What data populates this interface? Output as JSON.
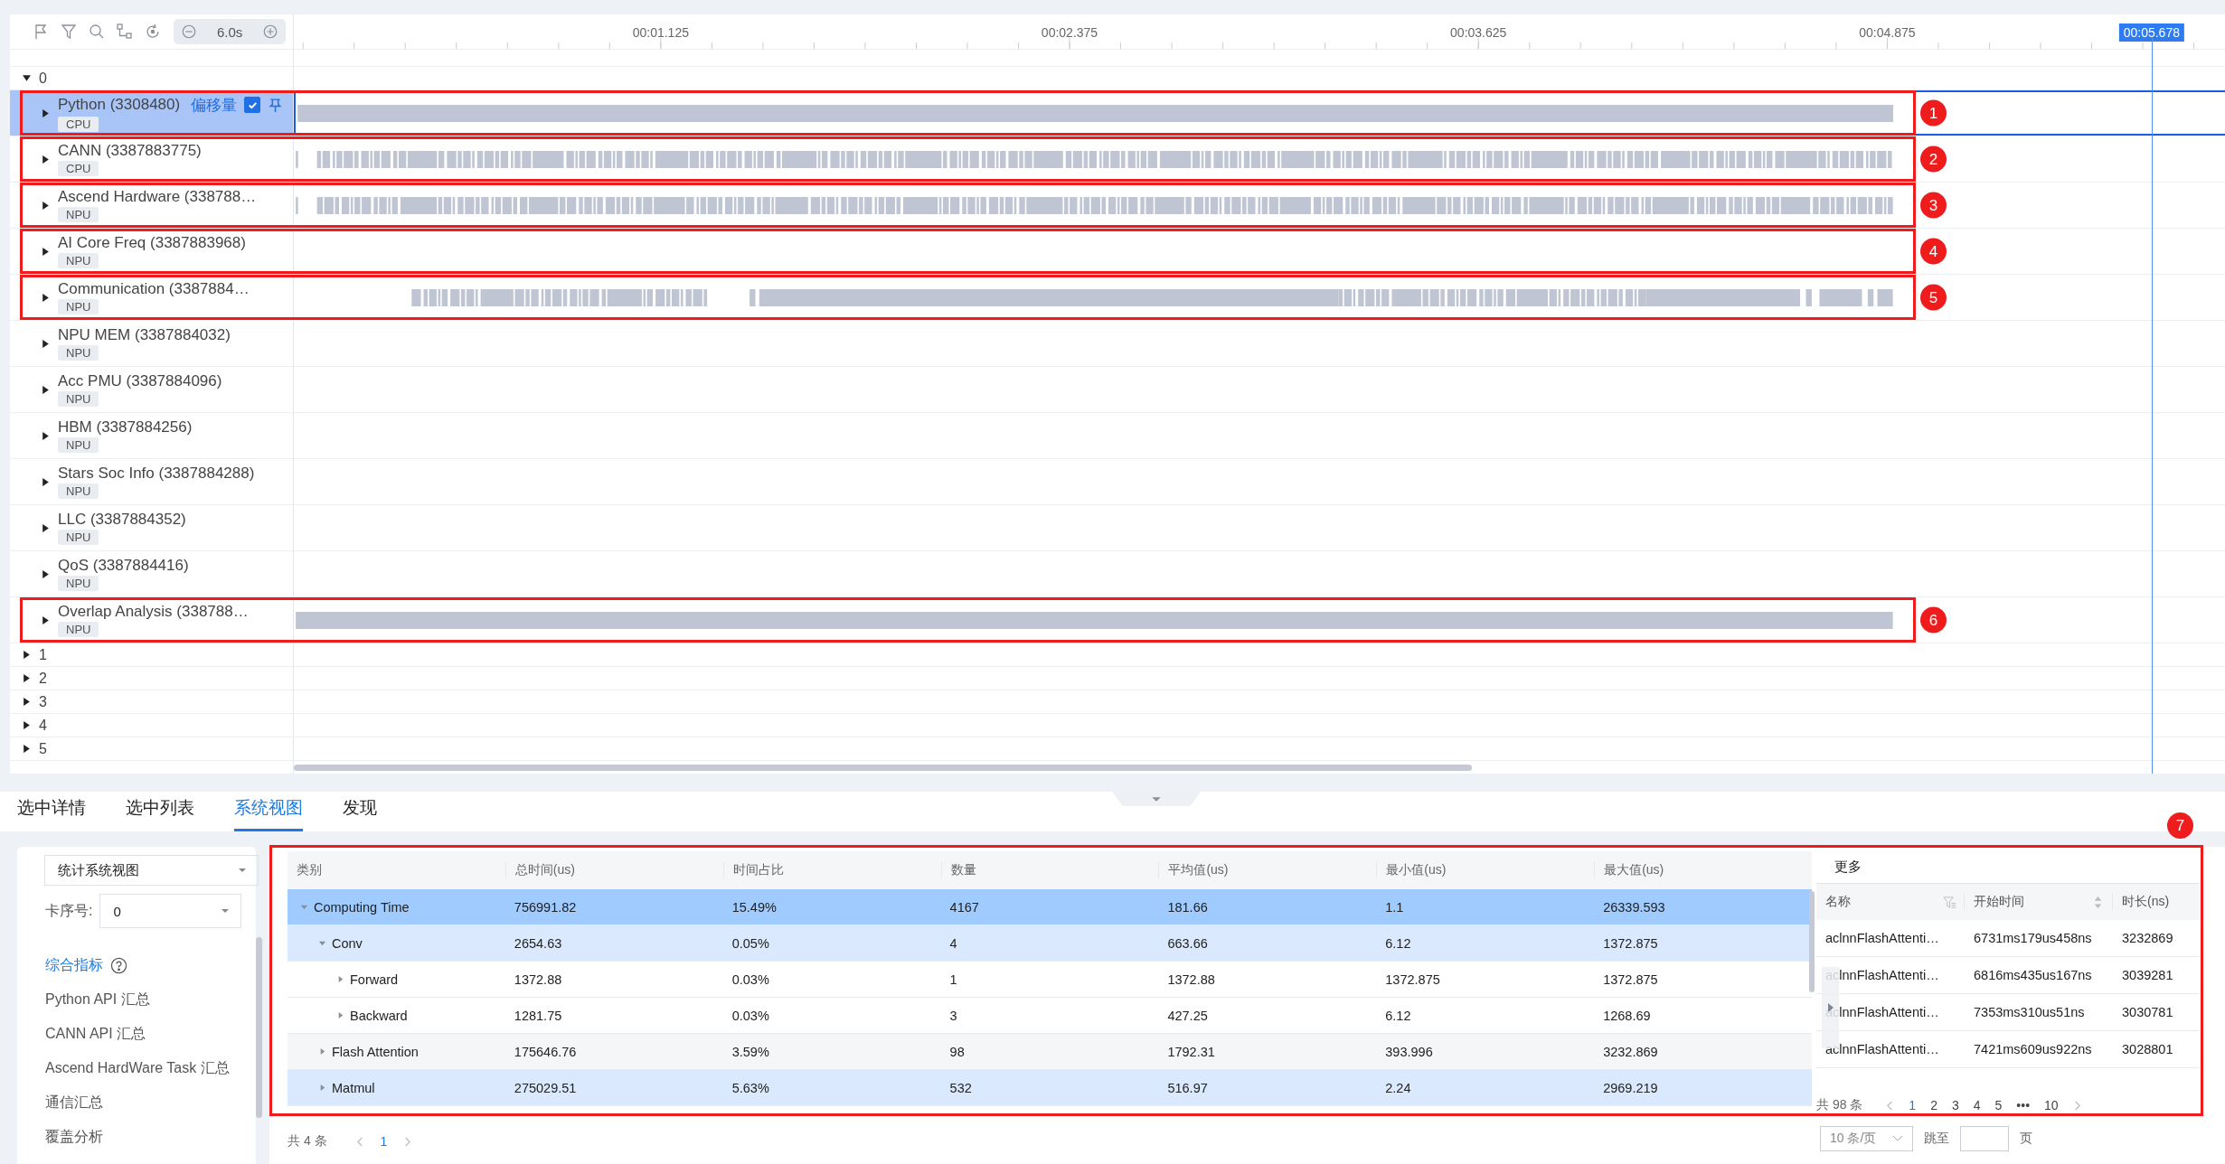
{
  "toolbar": {
    "zoom": "6.0s"
  },
  "ruler": {
    "labels": [
      "00:01.125",
      "00:02.375",
      "00:03.625",
      "00:04.875"
    ],
    "cursor": "00:05.678"
  },
  "groups": [
    {
      "label": "0",
      "expanded": true,
      "tracks": [
        {
          "name": "Python (3308480)",
          "tag": "CPU",
          "selected": true,
          "expanded": false,
          "kind": "solid",
          "callout": "1",
          "offset": {
            "label": "偏移量",
            "checked": true
          }
        },
        {
          "name": "CANN (3387883775)",
          "tag": "CPU",
          "selected": false,
          "expanded": false,
          "kind": "dense",
          "callout": "2"
        },
        {
          "name": "Ascend Hardware (338788…",
          "tag": "NPU",
          "selected": false,
          "expanded": false,
          "kind": "dense",
          "callout": "3"
        },
        {
          "name": "AI Core Freq (3387883968)",
          "tag": "NPU",
          "selected": false,
          "expanded": false,
          "kind": "empty",
          "callout": "4"
        },
        {
          "name": "Communication (3387884…",
          "tag": "NPU",
          "selected": false,
          "expanded": false,
          "kind": "split",
          "callout": "5"
        },
        {
          "name": "NPU MEM (3387884032)",
          "tag": "NPU",
          "selected": false,
          "expanded": false,
          "kind": "empty"
        },
        {
          "name": "Acc PMU (3387884096)",
          "tag": "NPU",
          "selected": false,
          "expanded": false,
          "kind": "empty"
        },
        {
          "name": "HBM (3387884256)",
          "tag": "NPU",
          "selected": false,
          "expanded": false,
          "kind": "empty"
        },
        {
          "name": "Stars Soc Info (3387884288)",
          "tag": "NPU",
          "selected": false,
          "expanded": false,
          "kind": "empty"
        },
        {
          "name": "LLC (3387884352)",
          "tag": "NPU",
          "selected": false,
          "expanded": false,
          "kind": "empty"
        },
        {
          "name": "QoS (3387884416)",
          "tag": "NPU",
          "selected": false,
          "expanded": false,
          "kind": "empty"
        },
        {
          "name": "Overlap Analysis (338788…",
          "tag": "NPU",
          "selected": false,
          "expanded": false,
          "kind": "solid",
          "callout": "6"
        }
      ]
    },
    {
      "label": "1",
      "expanded": false
    },
    {
      "label": "2",
      "expanded": false
    },
    {
      "label": "3",
      "expanded": false
    },
    {
      "label": "4",
      "expanded": false
    },
    {
      "label": "5",
      "expanded": false
    }
  ],
  "bottom_tabs": [
    {
      "label": "选中详情",
      "selected": false
    },
    {
      "label": "选中列表",
      "selected": false
    },
    {
      "label": "系统视图",
      "selected": true
    },
    {
      "label": "发现",
      "selected": false
    }
  ],
  "stats_panel": {
    "view_select": "统计系统视图",
    "card_label": "卡序号:",
    "card_select": "0",
    "menu": [
      {
        "label": "综合指标",
        "selected": true,
        "help": true
      },
      {
        "label": "Python API 汇总",
        "selected": false,
        "help": false
      },
      {
        "label": "CANN API 汇总",
        "selected": false,
        "help": false
      },
      {
        "label": "Ascend HardWare Task 汇总",
        "selected": false,
        "help": false
      },
      {
        "label": "通信汇总",
        "selected": false,
        "help": false
      },
      {
        "label": "覆盖分析",
        "selected": false,
        "help": false
      }
    ]
  },
  "summary_table": {
    "callout": "7",
    "columns": [
      "类别",
      "总时间(us)",
      "时间占比",
      "数量",
      "平均值(us)",
      "最小值(us)",
      "最大值(us)"
    ],
    "rows": [
      {
        "cells": [
          "Computing Time",
          "756991.82",
          "15.49%",
          "4167",
          "181.66",
          "1.1",
          "26339.593"
        ],
        "expanded": true,
        "selected": true,
        "children": [
          {
            "cells": [
              "Conv",
              "2654.63",
              "0.05%",
              "4",
              "663.66",
              "6.12",
              "1372.875"
            ],
            "expanded": true,
            "selected": false,
            "kind": "highlight",
            "children": [
              {
                "cells": [
                  "Forward",
                  "1372.88",
                  "0.03%",
                  "1",
                  "1372.88",
                  "1372.875",
                  "1372.875"
                ],
                "expanded": false,
                "selected": false
              },
              {
                "cells": [
                  "Backward",
                  "1281.75",
                  "0.03%",
                  "3",
                  "427.25",
                  "6.12",
                  "1268.69"
                ],
                "expanded": false,
                "selected": false
              }
            ]
          },
          {
            "cells": [
              "Flash Attention",
              "175646.76",
              "3.59%",
              "98",
              "1792.31",
              "393.996",
              "3232.869"
            ],
            "expanded": false,
            "selected": false,
            "kind": "stripe"
          },
          {
            "cells": [
              "Matmul",
              "275029.51",
              "5.63%",
              "532",
              "516.97",
              "2.24",
              "2969.219"
            ],
            "expanded": false,
            "selected": false,
            "kind": "highlight"
          }
        ]
      }
    ],
    "total": "共 4 条",
    "pages": [
      {
        "label": "1",
        "selected": true
      }
    ]
  },
  "more_panel": {
    "title": "更多",
    "columns": [
      {
        "label": "名称",
        "kind": "filter"
      },
      {
        "label": "开始时间",
        "kind": "sort"
      },
      {
        "label": "时长(ns)",
        "kind": "plain"
      }
    ],
    "rows": [
      [
        "aclnnFlashAttenti…",
        "6731ms179us458ns",
        "3232869"
      ],
      [
        "aclnnFlashAttenti…",
        "6816ms435us167ns",
        "3039281"
      ],
      [
        "aclnnFlashAttenti…",
        "7353ms310us51ns",
        "3030781"
      ],
      [
        "aclnnFlashAttenti…",
        "7421ms609us922ns",
        "3028801"
      ]
    ],
    "total": "共 98 条",
    "pages": [
      {
        "label": "1",
        "selected": true
      },
      {
        "label": "2",
        "selected": false
      },
      {
        "label": "3",
        "selected": false
      },
      {
        "label": "4",
        "selected": false
      },
      {
        "label": "5",
        "selected": false
      },
      {
        "label": "•••",
        "selected": false
      },
      {
        "label": "10",
        "selected": false
      }
    ],
    "page_size": "10 条/页",
    "jump_label": "跳至",
    "page_unit": "页"
  }
}
